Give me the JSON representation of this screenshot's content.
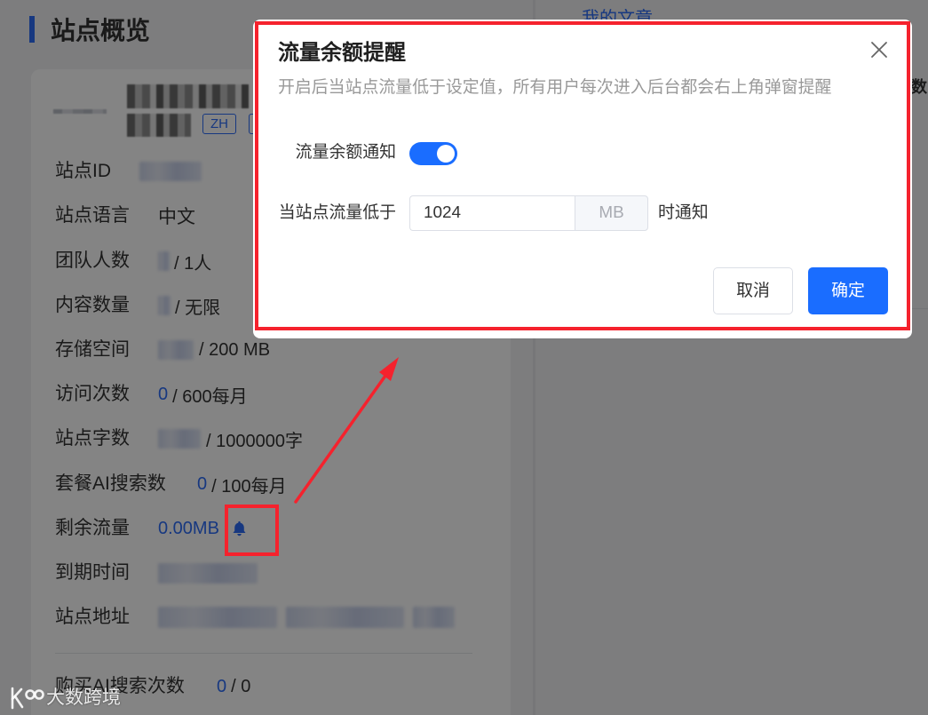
{
  "overview": {
    "title": "站点概览",
    "badges": [
      "ZH"
    ],
    "rows": [
      {
        "label": "站点ID"
      },
      {
        "label": "站点语言",
        "value": "中文"
      },
      {
        "label": "团队人数",
        "value": "/ 1人"
      },
      {
        "label": "内容数量",
        "value": "/ 无限"
      },
      {
        "label": "存储空间",
        "value": "/ 200 MB"
      },
      {
        "label": "访问次数",
        "used": "0",
        "value": "/ 600每月"
      },
      {
        "label": "站点字数",
        "value": "/ 1000000字"
      },
      {
        "label": "套餐AI搜索数",
        "used": "0",
        "value": "/ 100每月"
      },
      {
        "label": "剩余流量",
        "used": "0.00MB",
        "icon": "bell-icon"
      },
      {
        "label": "到期时间"
      },
      {
        "label": "站点地址"
      }
    ],
    "purchase": {
      "label": "购买AI搜索次数",
      "used": "0",
      "value": "/ 0"
    }
  },
  "right_panel": {
    "tab": "我的文章",
    "column_header": "数"
  },
  "modal": {
    "title": "流量余额提醒",
    "description": "开启后当站点流量低于设定值，所有用户每次进入后台都会右上角弹窗提醒",
    "toggle_label": "流量余额通知",
    "toggle_on": true,
    "threshold_label": "当站点流量低于",
    "threshold_value": "1024",
    "threshold_unit": "MB",
    "threshold_suffix": "时通知",
    "cancel_label": "取消",
    "confirm_label": "确定",
    "close_icon": "close-icon"
  },
  "watermark": {
    "text": "大数跨境",
    "logo_icon": "brand-logo-icon"
  },
  "colors": {
    "primary": "#1a6dff",
    "value_blue": "#2d6cf6",
    "annotation": "#f5222d"
  }
}
